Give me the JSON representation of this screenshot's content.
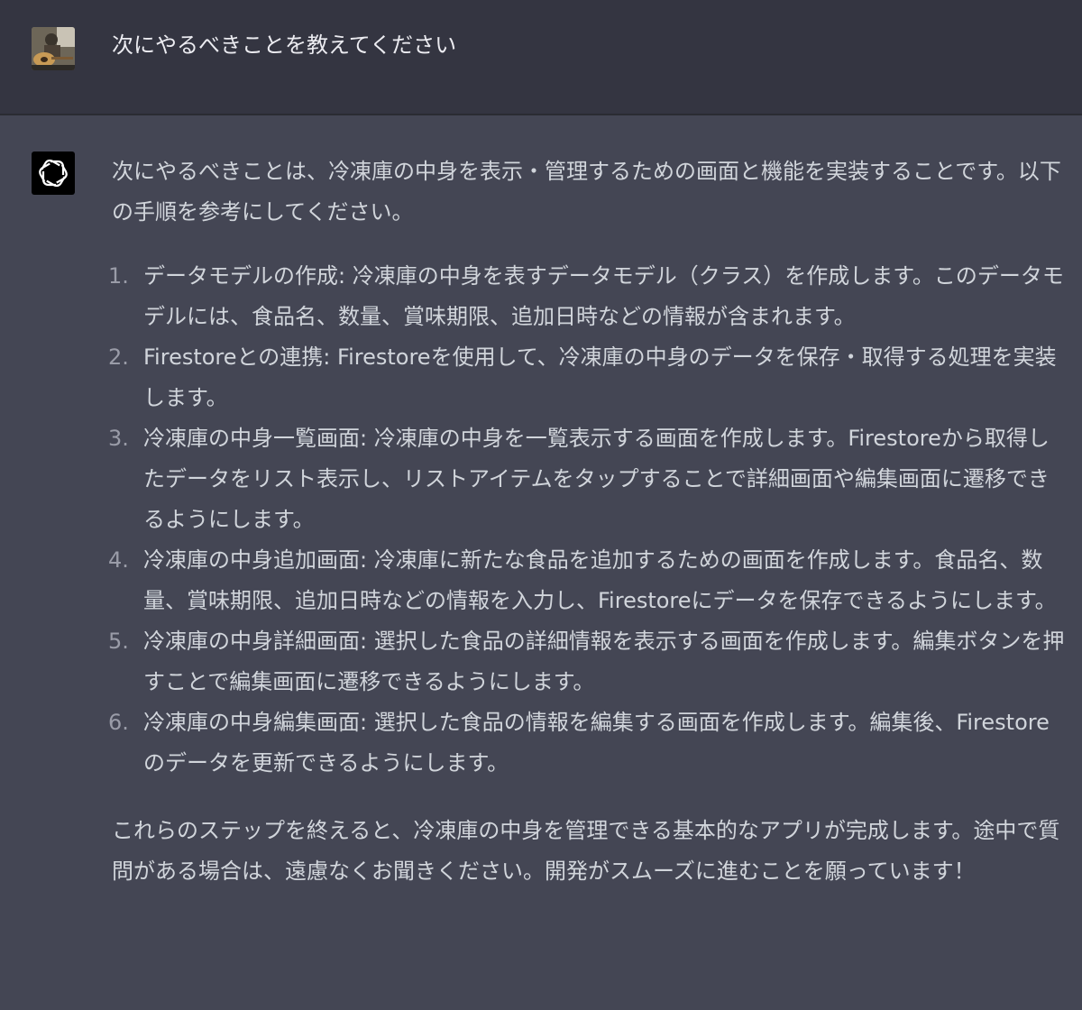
{
  "user_message": {
    "avatar": "user-photo-avatar",
    "text": "次にやるべきことを教えてください"
  },
  "assistant_message": {
    "avatar": "openai-logo-icon",
    "intro": "次にやるべきことは、冷凍庫の中身を表示・管理するための画面と機能を実装することです。以下の手順を参考にしてください。",
    "steps": [
      {
        "number": "1.",
        "title": "データモデルの作成:",
        "text": "冷凍庫の中身を表すデータモデル（クラス）を作成します。このデータモデルには、食品名、数量、賞味期限、追加日時などの情報が含まれます。"
      },
      {
        "number": "2.",
        "title": "Firestoreとの連携:",
        "text": "Firestoreを使用して、冷凍庫の中身のデータを保存・取得する処理を実装します。"
      },
      {
        "number": "3.",
        "title": "冷凍庫の中身一覧画面:",
        "text": "冷凍庫の中身を一覧表示する画面を作成します。Firestoreから取得したデータをリスト表示し、リストアイテムをタップすることで詳細画面や編集画面に遷移できるようにします。"
      },
      {
        "number": "4.",
        "title": "冷凍庫の中身追加画面:",
        "text": "冷凍庫に新たな食品を追加するための画面を作成します。食品名、数量、賞味期限、追加日時などの情報を入力し、Firestoreにデータを保存できるようにします。"
      },
      {
        "number": "5.",
        "title": "冷凍庫の中身詳細画面:",
        "text": "選択した食品の詳細情報を表示する画面を作成します。編集ボタンを押すことで編集画面に遷移できるようにします。"
      },
      {
        "number": "6.",
        "title": "冷凍庫の中身編集画面:",
        "text": "選択した食品の情報を編集する画面を作成します。編集後、Firestoreのデータを更新できるようにします。"
      }
    ],
    "closing": "これらのステップを終えると、冷凍庫の中身を管理できる基本的なアプリが完成します。途中で質問がある場合は、遠慮なくお聞きください。開発がスムーズに進むことを願っています！"
  }
}
